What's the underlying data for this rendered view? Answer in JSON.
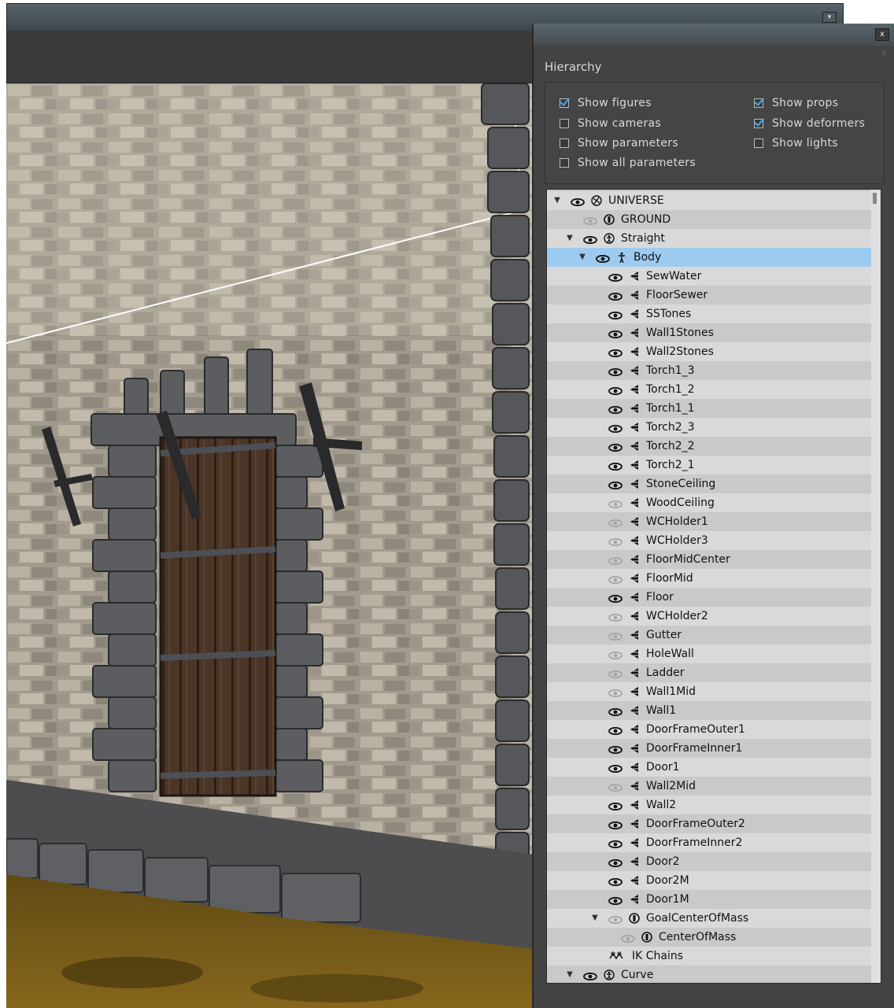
{
  "panel": {
    "title": "Hierarchy",
    "close_label": "x"
  },
  "options": [
    {
      "label": "Show figures",
      "checked": true
    },
    {
      "label": "Show props",
      "checked": true
    },
    {
      "label": "Show cameras",
      "checked": false
    },
    {
      "label": "Show deformers",
      "checked": true
    },
    {
      "label": "Show parameters",
      "checked": false
    },
    {
      "label": "Show lights",
      "checked": false
    },
    {
      "label": "Show all parameters",
      "checked": false
    }
  ],
  "tree": [
    {
      "label": "UNIVERSE",
      "depth": 0,
      "expanded": true,
      "icon": "universe-icon",
      "eye": "visible"
    },
    {
      "label": "GROUND",
      "depth": 1,
      "icon": "ground-icon",
      "eye": "hidden"
    },
    {
      "label": "Straight",
      "depth": 1,
      "expanded": true,
      "icon": "figure-icon",
      "eye": "visible"
    },
    {
      "label": "Body",
      "depth": 2,
      "expanded": true,
      "icon": "body-icon",
      "eye": "visible",
      "selected": true
    },
    {
      "label": "SewWater",
      "depth": 3,
      "icon": "prop-icon",
      "eye": "visible"
    },
    {
      "label": "FloorSewer",
      "depth": 3,
      "icon": "prop-icon",
      "eye": "visible"
    },
    {
      "label": "SSTones",
      "depth": 3,
      "icon": "prop-icon",
      "eye": "visible"
    },
    {
      "label": "Wall1Stones",
      "depth": 3,
      "icon": "prop-icon",
      "eye": "visible"
    },
    {
      "label": "Wall2Stones",
      "depth": 3,
      "icon": "prop-icon",
      "eye": "visible"
    },
    {
      "label": "Torch1_3",
      "depth": 3,
      "icon": "prop-icon",
      "eye": "visible"
    },
    {
      "label": "Torch1_2",
      "depth": 3,
      "icon": "prop-icon",
      "eye": "visible"
    },
    {
      "label": "Torch1_1",
      "depth": 3,
      "icon": "prop-icon",
      "eye": "visible"
    },
    {
      "label": "Torch2_3",
      "depth": 3,
      "icon": "prop-icon",
      "eye": "visible"
    },
    {
      "label": "Torch2_2",
      "depth": 3,
      "icon": "prop-icon",
      "eye": "visible"
    },
    {
      "label": "Torch2_1",
      "depth": 3,
      "icon": "prop-icon",
      "eye": "visible"
    },
    {
      "label": "StoneCeiling",
      "depth": 3,
      "icon": "prop-icon",
      "eye": "visible"
    },
    {
      "label": "WoodCeiling",
      "depth": 3,
      "icon": "prop-icon",
      "eye": "hidden"
    },
    {
      "label": "WCHolder1",
      "depth": 3,
      "icon": "prop-icon",
      "eye": "hidden"
    },
    {
      "label": "WCHolder3",
      "depth": 3,
      "icon": "prop-icon",
      "eye": "hidden"
    },
    {
      "label": "FloorMidCenter",
      "depth": 3,
      "icon": "prop-icon",
      "eye": "hidden"
    },
    {
      "label": "FloorMid",
      "depth": 3,
      "icon": "prop-icon",
      "eye": "hidden"
    },
    {
      "label": "Floor",
      "depth": 3,
      "icon": "prop-icon",
      "eye": "visible"
    },
    {
      "label": "WCHolder2",
      "depth": 3,
      "icon": "prop-icon",
      "eye": "hidden"
    },
    {
      "label": "Gutter",
      "depth": 3,
      "icon": "prop-icon",
      "eye": "hidden"
    },
    {
      "label": "HoleWall",
      "depth": 3,
      "icon": "prop-icon",
      "eye": "hidden"
    },
    {
      "label": "Ladder",
      "depth": 3,
      "icon": "prop-icon",
      "eye": "hidden"
    },
    {
      "label": "Wall1Mid",
      "depth": 3,
      "icon": "prop-icon",
      "eye": "hidden"
    },
    {
      "label": "Wall1",
      "depth": 3,
      "icon": "prop-icon",
      "eye": "visible"
    },
    {
      "label": "DoorFrameOuter1",
      "depth": 3,
      "icon": "prop-icon",
      "eye": "visible"
    },
    {
      "label": "DoorFrameInner1",
      "depth": 3,
      "icon": "prop-icon",
      "eye": "visible"
    },
    {
      "label": "Door1",
      "depth": 3,
      "icon": "prop-icon",
      "eye": "visible"
    },
    {
      "label": "Wall2Mid",
      "depth": 3,
      "icon": "prop-icon",
      "eye": "hidden"
    },
    {
      "label": "Wall2",
      "depth": 3,
      "icon": "prop-icon",
      "eye": "visible"
    },
    {
      "label": "DoorFrameOuter2",
      "depth": 3,
      "icon": "prop-icon",
      "eye": "visible"
    },
    {
      "label": "DoorFrameInner2",
      "depth": 3,
      "icon": "prop-icon",
      "eye": "visible"
    },
    {
      "label": "Door2",
      "depth": 3,
      "icon": "prop-icon",
      "eye": "visible"
    },
    {
      "label": "Door2M",
      "depth": 3,
      "icon": "prop-icon",
      "eye": "visible"
    },
    {
      "label": "Door1M",
      "depth": 3,
      "icon": "prop-icon",
      "eye": "visible"
    },
    {
      "label": "GoalCenterOfMass",
      "depth": 3,
      "expanded": true,
      "icon": "ground-icon",
      "eye": "hidden",
      "toggle_only": true
    },
    {
      "label": "CenterOfMass",
      "depth": 4,
      "icon": "ground-icon",
      "eye": "hidden"
    },
    {
      "label": "IK Chains",
      "depth": 3,
      "icon": "ik-chain-icon",
      "eye": "none"
    },
    {
      "label": "Curve",
      "depth": 1,
      "expanded": true,
      "icon": "figure-icon",
      "eye": "visible"
    }
  ],
  "colors": {
    "selection": "#9dcbef",
    "check": "#46a8f0",
    "panel_bg": "#434343"
  }
}
